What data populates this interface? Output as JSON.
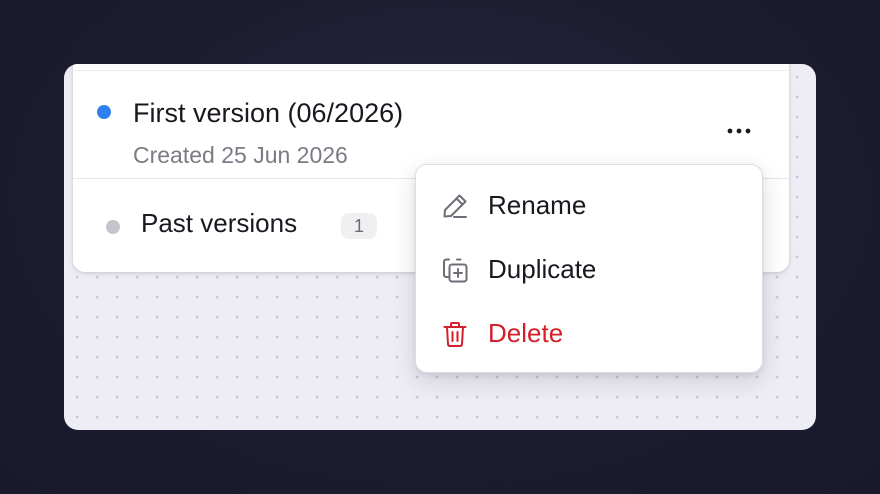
{
  "current_version": {
    "title": "First version (06/2026)",
    "created": "Created 25 Jun 2026",
    "status_color": "#2f80ed",
    "more_icon": "more-horizontal-icon"
  },
  "past_versions": {
    "label": "Past versions",
    "count": "1",
    "status_color": "#c5c5cc"
  },
  "context_menu": {
    "items": [
      {
        "label": "Rename",
        "icon": "pencil-icon",
        "color": "#18181f"
      },
      {
        "label": "Duplicate",
        "icon": "duplicate-icon",
        "color": "#18181f"
      },
      {
        "label": "Delete",
        "icon": "trash-icon",
        "color": "#d4202a"
      }
    ]
  }
}
